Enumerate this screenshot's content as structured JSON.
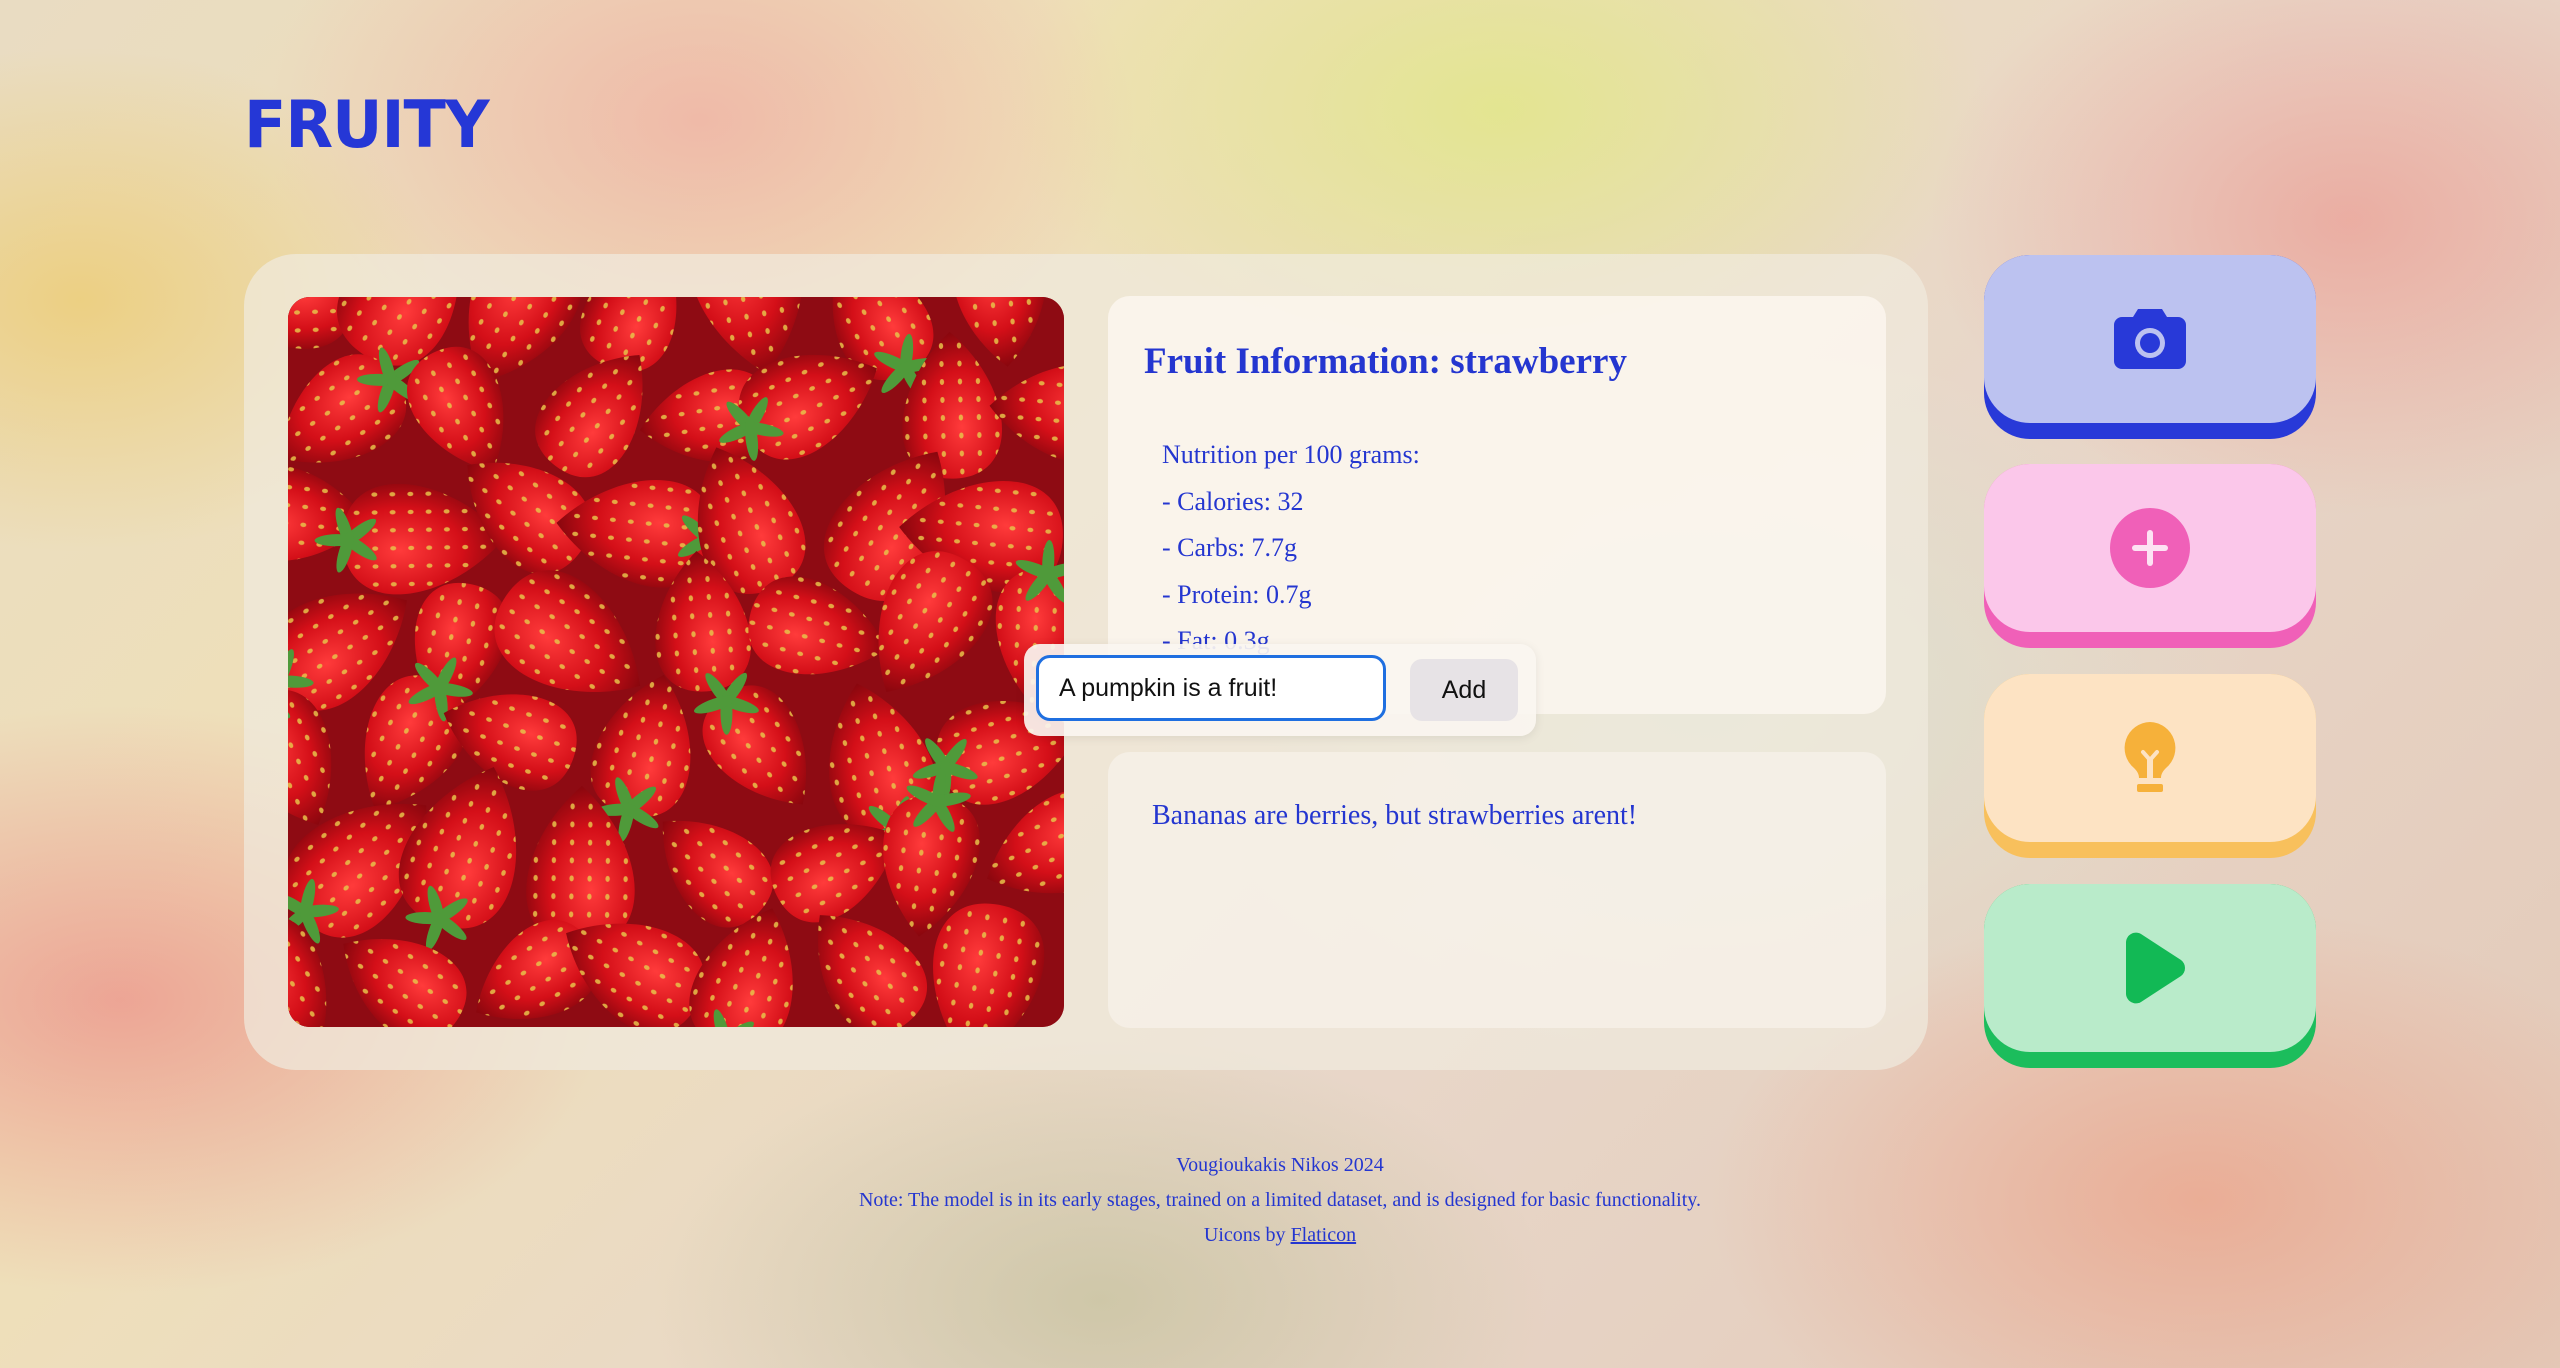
{
  "app": {
    "logo": "FRUITY"
  },
  "info": {
    "title": "Fruit Information: strawberry",
    "nutrition": [
      "Nutrition per 100 grams:",
      "- Calories: 32",
      "- Carbs: 7.7g",
      "- Protein: 0.7g",
      "- Fat: 0.3g"
    ]
  },
  "fact": {
    "text": "Bananas are berries, but strawberries arent!"
  },
  "add_fact": {
    "input_value": "A pumpkin is a fruit!",
    "button_label": "Add"
  },
  "actions": [
    {
      "icon": "camera-icon",
      "accent": "#2839d8",
      "fill": "#bcc2f0"
    },
    {
      "icon": "plus-circle-icon",
      "accent": "#f060b8",
      "fill": "#fbc7ea"
    },
    {
      "icon": "lightbulb-icon",
      "accent": "#f8c05c",
      "fill": "#fde3c3"
    },
    {
      "icon": "play-icon",
      "accent": "#1cbd5c",
      "fill": "#b9ebca"
    }
  ],
  "footer": {
    "author": "Vougioukakis Nikos 2024",
    "note": "Note: The model is in its early stages, trained on a limited dataset, and is designed for basic functionality.",
    "credit_prefix": "Uicons by ",
    "credit_link": "Flaticon"
  },
  "colors": {
    "brand_blue": "#2537d6"
  }
}
